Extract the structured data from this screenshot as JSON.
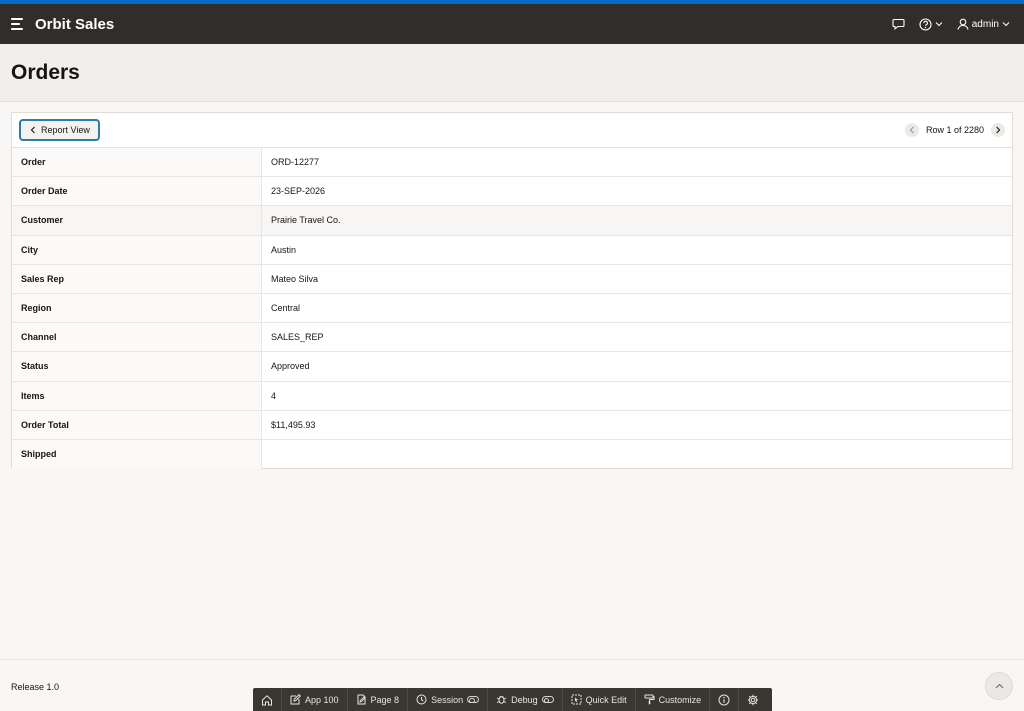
{
  "colors": {
    "accent": "#056ac8",
    "navbar": "#312d2a",
    "focus_ring": "#2e7da8",
    "devbar": "#3a3632"
  },
  "navbar": {
    "app_title": "Orbit Sales",
    "menu_icon": "hamburger-icon",
    "feedback_icon": "chat-bubble-icon",
    "help_icon": "help-circle-icon",
    "user_icon": "user-icon",
    "username": "admin"
  },
  "page": {
    "title": "Orders"
  },
  "toolbar": {
    "report_view_label": "Report View",
    "pager_text": "Row 1 of 2280"
  },
  "record": [
    {
      "label": "Order",
      "value": "ORD-12277"
    },
    {
      "label": "Order Date",
      "value": "23-SEP-2026"
    },
    {
      "label": "Customer",
      "value": "Prairie Travel Co."
    },
    {
      "label": "City",
      "value": "Austin"
    },
    {
      "label": "Sales Rep",
      "value": "Mateo Silva"
    },
    {
      "label": "Region",
      "value": "Central"
    },
    {
      "label": "Channel",
      "value": "SALES_REP"
    },
    {
      "label": "Status",
      "value": "Approved"
    },
    {
      "label": "Items",
      "value": "4"
    },
    {
      "label": "Order Total",
      "value": "$11,495.93"
    },
    {
      "label": "Shipped",
      "value": ""
    }
  ],
  "footer": {
    "release": "Release 1.0"
  },
  "devbar": {
    "home_icon": "home-icon",
    "app": "App 100",
    "page": "Page 8",
    "session": "Session",
    "debug": "Debug",
    "quick_edit": "Quick Edit",
    "customize": "Customize",
    "info_icon": "info-icon",
    "settings_icon": "gear-icon"
  }
}
